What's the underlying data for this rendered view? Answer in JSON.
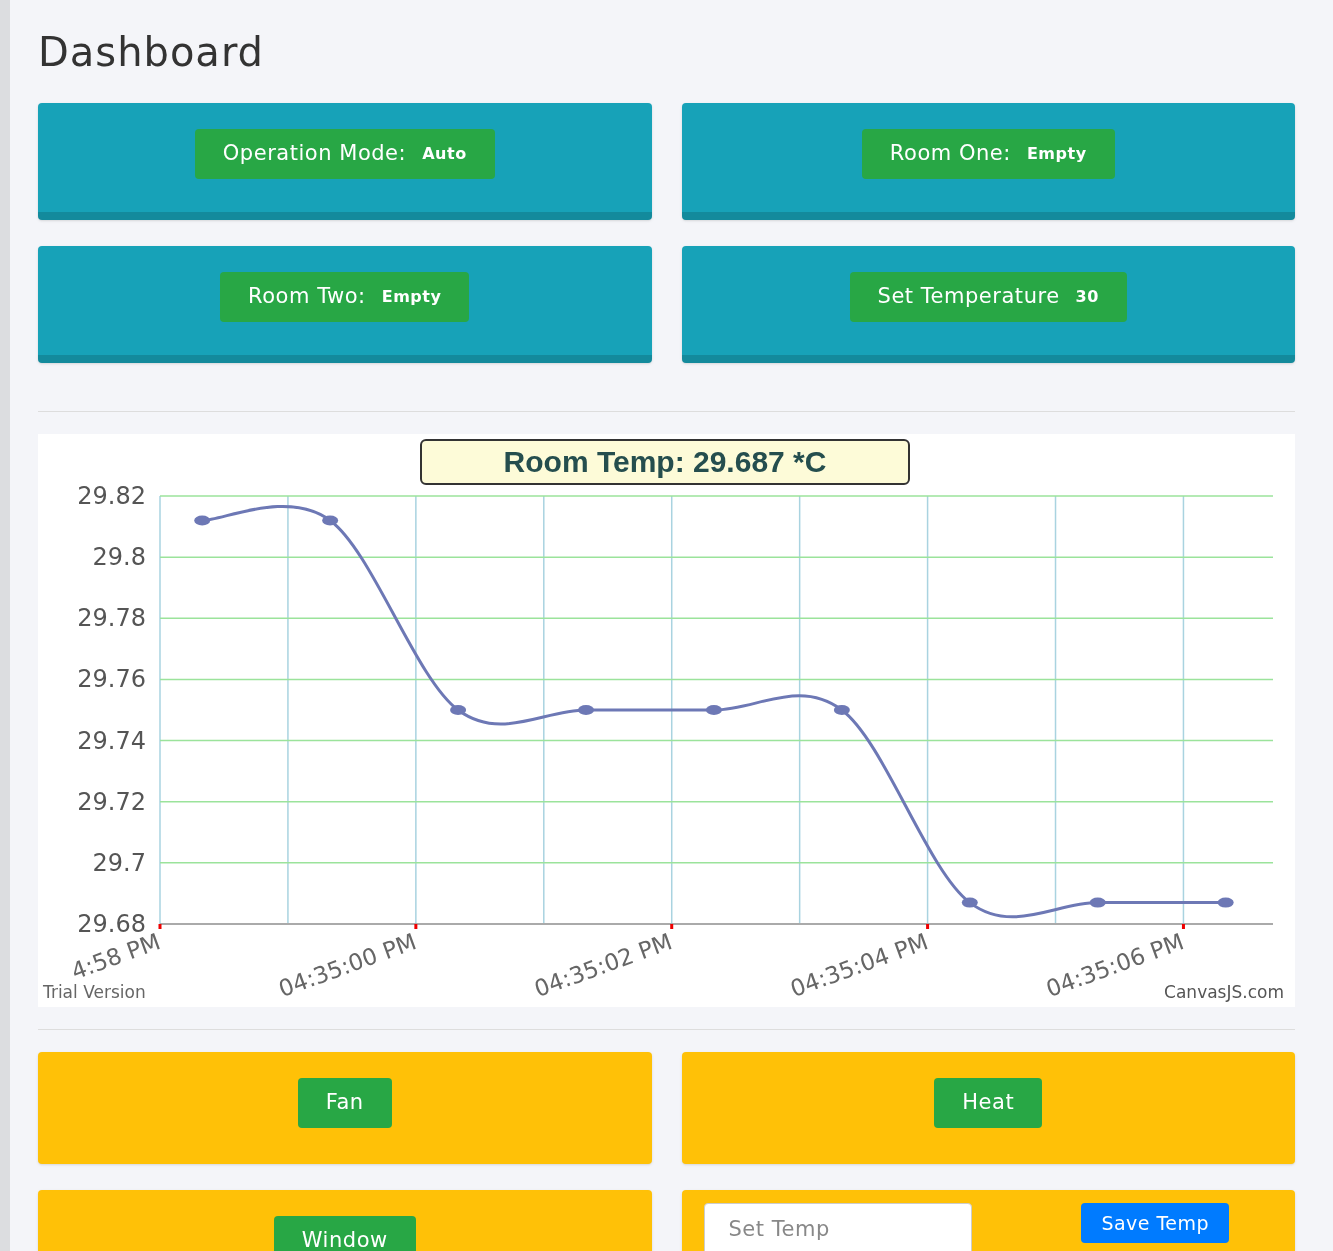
{
  "page": {
    "title": "Dashboard"
  },
  "status_cards": [
    {
      "label": "Operation Mode:",
      "value": "Auto"
    },
    {
      "label": "Room One:",
      "value": "Empty"
    },
    {
      "label": "Room Two:",
      "value": "Empty"
    },
    {
      "label": "Set Temperature",
      "value": "30"
    }
  ],
  "temperature_chart": {
    "chart_data": {
      "type": "line",
      "title": "Room Temp: 29.687 *C",
      "categories": [
        "4:58 PM",
        null,
        "04:35:00 PM",
        null,
        "04:35:02 PM",
        null,
        "04:35:04 PM",
        null,
        "04:35:06 PM"
      ],
      "grid": true,
      "series": [
        {
          "color": "#6d78b5",
          "marker": true,
          "values": [
            29.812,
            29.812,
            29.75,
            29.75,
            29.75,
            29.75,
            29.687,
            29.687,
            29.687
          ]
        }
      ],
      "ylim": [
        29.68,
        29.82
      ],
      "yticks": [
        29.68,
        29.7,
        29.72,
        29.74,
        29.76,
        29.78,
        29.8,
        29.82
      ]
    },
    "trial_note": "Trial Version",
    "credit": "CanvasJS.com"
  },
  "controls": [
    {
      "kind": "button",
      "label": "Fan"
    },
    {
      "kind": "button",
      "label": "Heat"
    },
    {
      "kind": "button",
      "label": "Window"
    },
    {
      "kind": "form",
      "placeholder": "Set Temp",
      "button": "Save Temp"
    }
  ]
}
